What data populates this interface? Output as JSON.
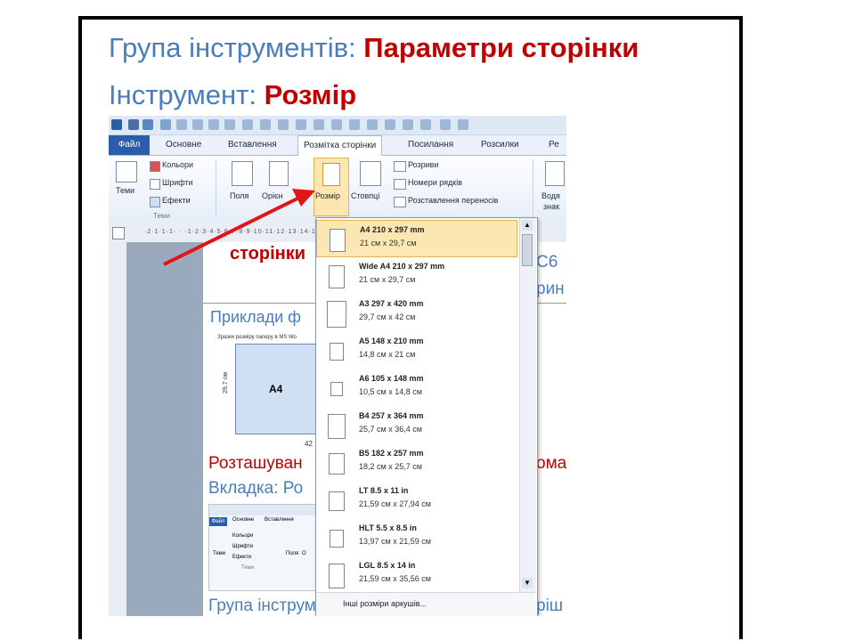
{
  "title_line1": {
    "prefix": "Група інструментів:",
    "highlight": "Параметри сторінки"
  },
  "title_line2": {
    "prefix": "Інструмент:",
    "highlight": "Розмір"
  },
  "ribbon": {
    "tabs": [
      "Файл",
      "Основне",
      "Вставлення",
      "Розмітка сторінки",
      "Посилання",
      "Розсилки",
      "Ре"
    ],
    "active_tab": "Розмітка сторінки",
    "themes": {
      "label": "Теми",
      "group_label": "Теми",
      "colors": "Кольори",
      "fonts": "Шрифти",
      "effects": "Ефекти"
    },
    "page_setup": {
      "fields": "Поля",
      "orientation": "Орієн",
      "size": "Розмір",
      "columns": "Стовпці",
      "breaks": "Розриви",
      "line_numbers": "Номери рядків",
      "hyphenation": "Розставлення переносів"
    },
    "watermark": {
      "line1": "Водя",
      "line2": "знак"
    }
  },
  "document": {
    "snippet1": "сторінки",
    "snippet2": "Приклади ф",
    "small_caption": "Зразки розміру паперу в MS Wo",
    "sheet_label": "A4",
    "sheet_side": "29,7 см",
    "sheet_bottom": "42",
    "snippet3": "Розташуван",
    "snippet4": "Вкладка: Ро",
    "snippet5": "Група інструм",
    "right1": "С6",
    "right2": "рин",
    "right3": "ома",
    "right4": "ріш"
  },
  "mini_ribbon": {
    "file": "Файл",
    "home": "Основне",
    "insert": "Вставлення",
    "colors": "Кольори",
    "fonts": "Шрифти",
    "effects": "Ефекти",
    "themes": "Теми",
    "fields": "Поля",
    "orient": "О",
    "group": "Теми"
  },
  "size_dropdown": {
    "items": [
      {
        "name": "A4 210 x 297 mm",
        "dims": "21 см x 29,7 см",
        "selected": true
      },
      {
        "name": "Wide A4 210 x 297 mm",
        "dims": "21 см x 29,7 см"
      },
      {
        "name": "A3 297 x 420 mm",
        "dims": "29,7 см x 42 см"
      },
      {
        "name": "A5 148 x 210 mm",
        "dims": "14,8 см x 21 см"
      },
      {
        "name": "A6 105 x 148 mm",
        "dims": "10,5 см x 14,8 см"
      },
      {
        "name": "B4 257 x 364 mm",
        "dims": "25,7 см x 36,4 см"
      },
      {
        "name": "B5 182 x 257 mm",
        "dims": "18,2 см x 25,7 см"
      },
      {
        "name": "LT 8.5 x 11 in",
        "dims": "21,59 см x 27,94 см"
      },
      {
        "name": "HLT 5.5 x 8.5 in",
        "dims": "13,97 см x 21,59 см"
      },
      {
        "name": "LGL 8.5 x 14 in",
        "dims": "21,59 см x 35,56 см"
      }
    ],
    "more": "Інші розміри аркушів..."
  },
  "colors": {
    "title_blue": "#4A7EBB",
    "title_red": "#C00000",
    "arrow": "#E31414",
    "file_tab": "#2A5EA8",
    "highlight": "#FCE7B2"
  }
}
